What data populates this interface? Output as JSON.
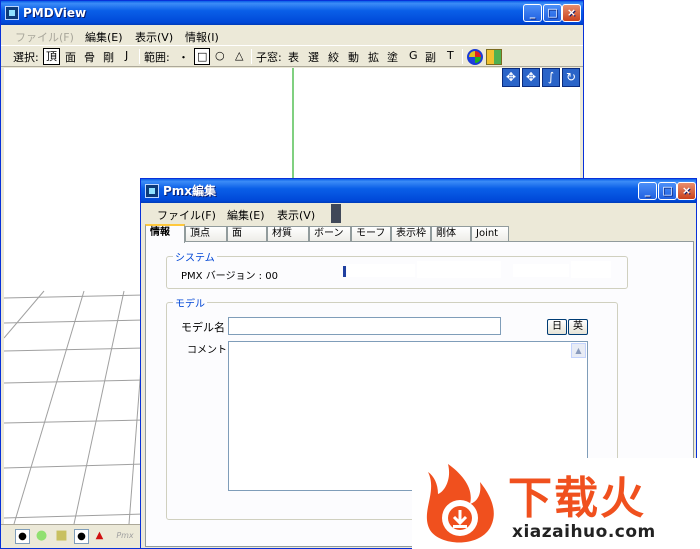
{
  "main_window": {
    "title": "PMDView",
    "menu": [
      "ファイル(F)",
      "編集(E)",
      "表示(V)",
      "情報(I)"
    ],
    "toolbar": {
      "select_label": "選択:",
      "select_items": [
        "頂",
        "面",
        "骨",
        "剛",
        "J"
      ],
      "range_label": "範囲:",
      "range_items": [
        "・",
        "□",
        "○",
        "△"
      ],
      "window_label": "子窓:",
      "window_items": [
        "表",
        "選",
        "絞",
        "動",
        "拡",
        "塗",
        "G",
        "副",
        "T"
      ]
    },
    "status_bar": {
      "items": [
        "●",
        "●",
        "■",
        "●",
        "▲",
        "Pmx"
      ]
    }
  },
  "pmx_window": {
    "title": "Pmx編集",
    "menu": [
      "ファイル(F)",
      "編集(E)",
      "表示(V)"
    ],
    "tabs": [
      "情報",
      "頂点",
      "面",
      "材質",
      "ボーン",
      "モーフ",
      "表示枠",
      "剛体",
      "Joint"
    ],
    "system_group": {
      "title": "システム",
      "version_label": "PMX バージョン : 00"
    },
    "model_group": {
      "title": "モデル",
      "name_label": "モデル名",
      "comment_label": "コメント",
      "model_name_value": "",
      "lang_jp": "日",
      "lang_en": "英"
    }
  },
  "watermark": {
    "brand": "下载火",
    "url": "xiazaihuo.com"
  },
  "colors": {
    "title_bar": "#0a5fe8",
    "window_bg": "#ece9d8",
    "group_title": "#0046d5",
    "axis_green": "#00a000",
    "brand_orange": "#f0501e"
  }
}
